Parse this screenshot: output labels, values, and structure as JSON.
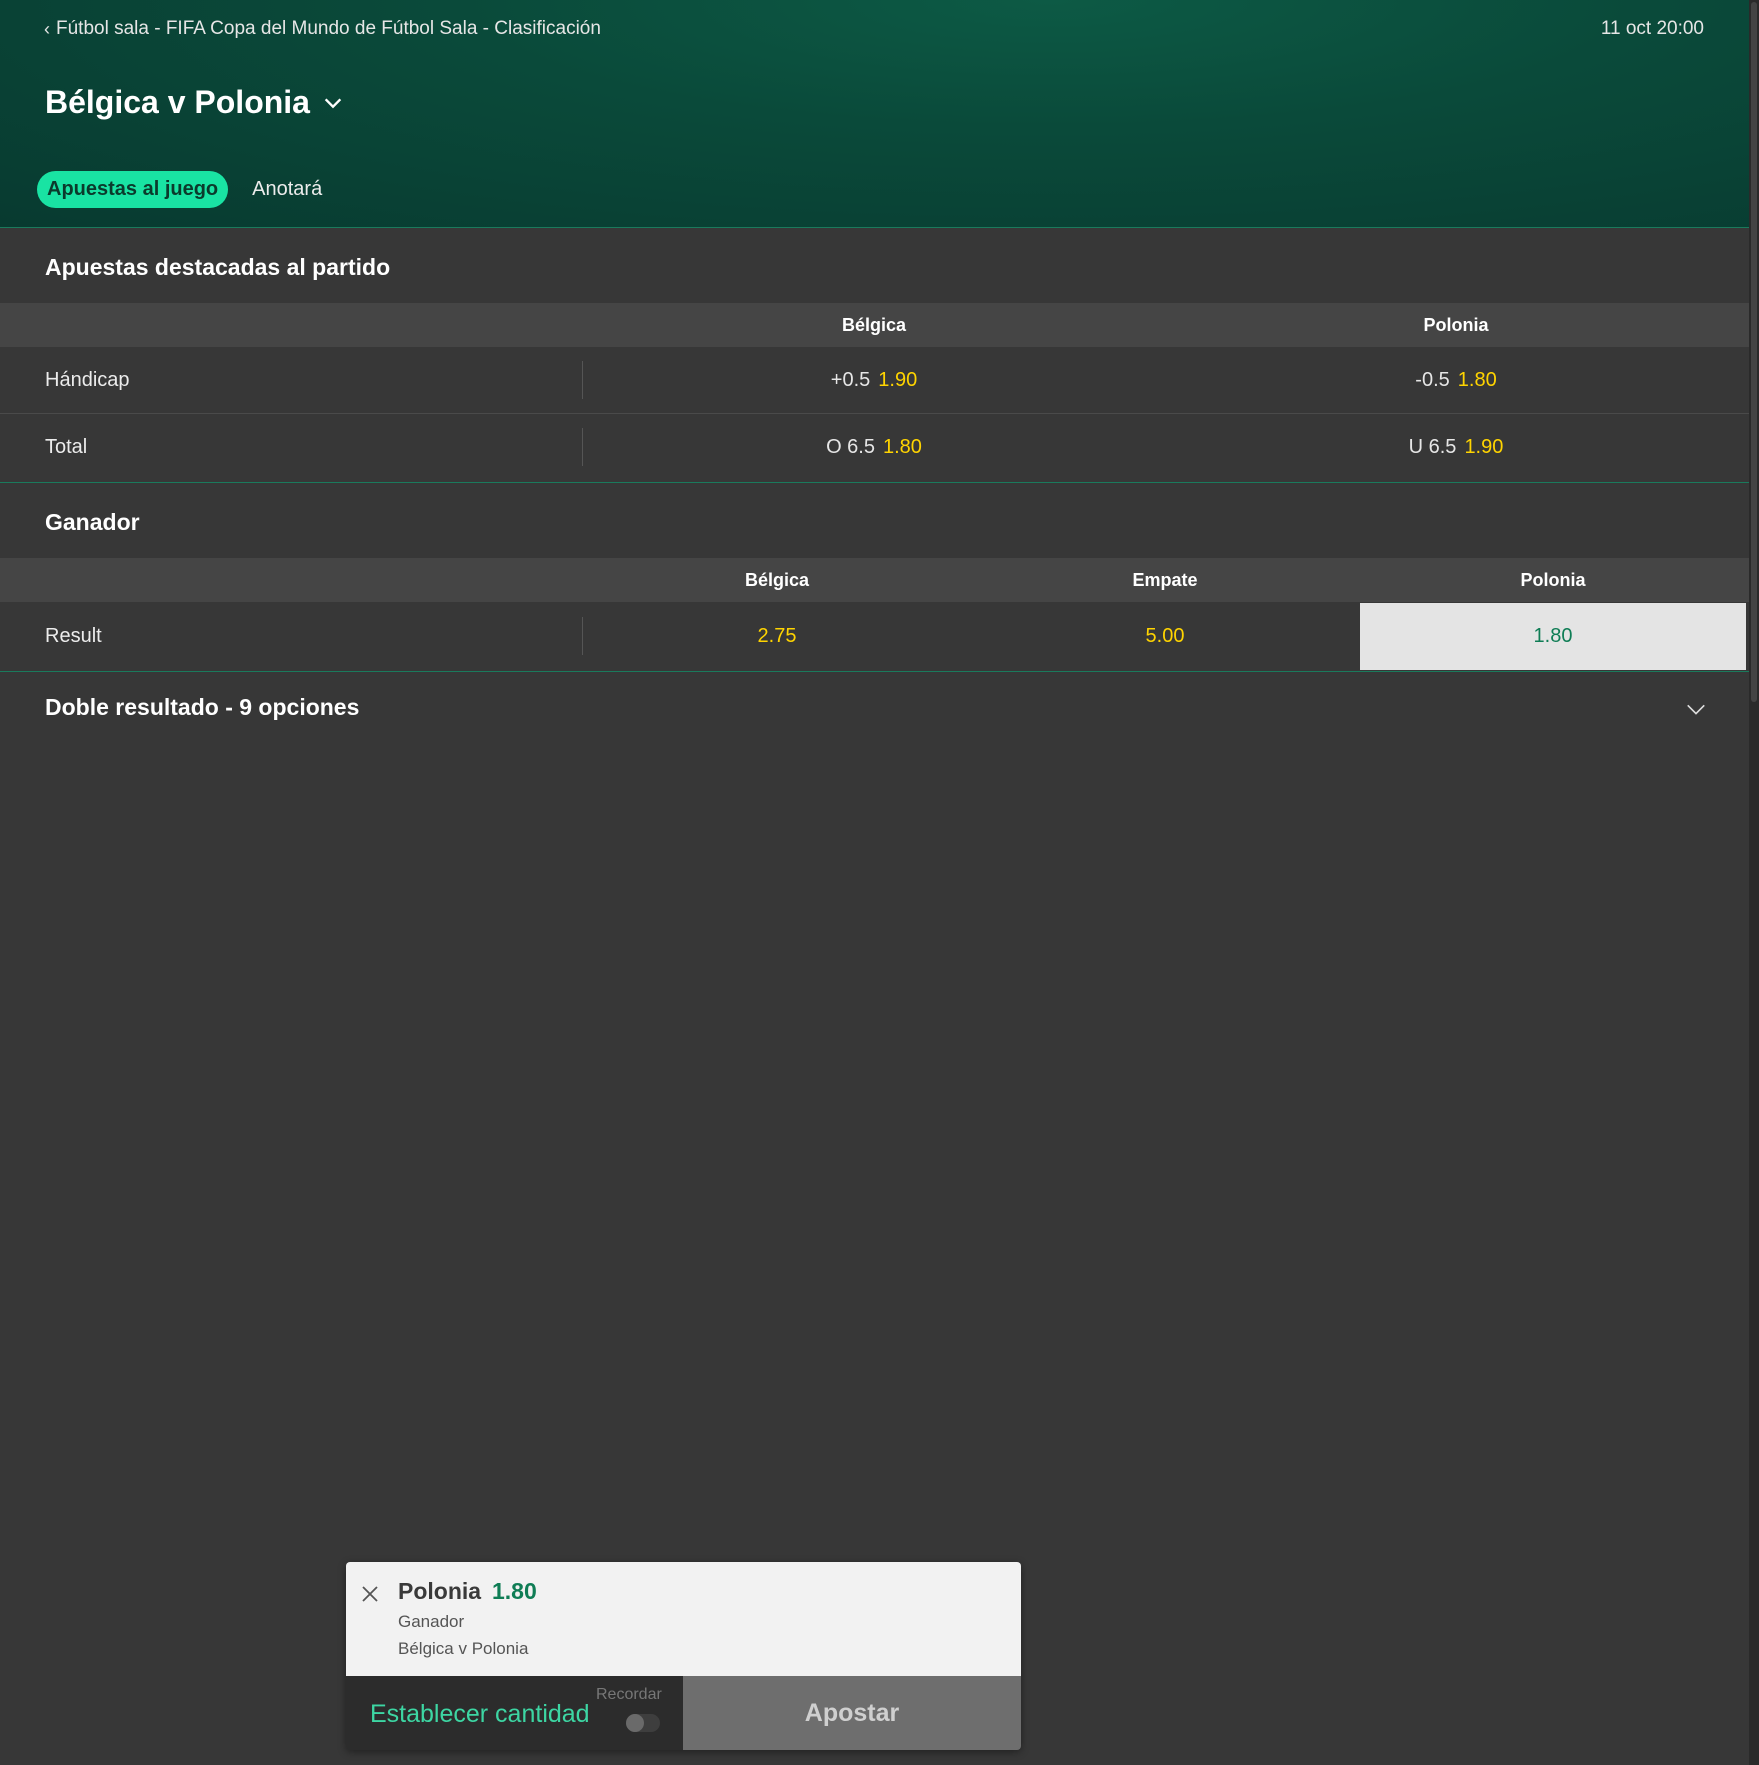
{
  "header": {
    "breadcrumb": "Fútbol sala - FIFA Copa del Mundo de Fútbol Sala - Clasificación",
    "datetime": "11 oct 20:00",
    "match_title": "Bélgica v Polonia",
    "tabs": [
      {
        "label": "Apuestas al juego",
        "active": true
      },
      {
        "label": "Anotará",
        "active": false
      }
    ]
  },
  "featured": {
    "title": "Apuestas destacadas al partido",
    "columns": [
      "Bélgica",
      "Polonia"
    ],
    "rows": [
      {
        "label": "Hándicap",
        "outcomes": [
          {
            "line": "+0.5",
            "price": "1.90"
          },
          {
            "line": "-0.5",
            "price": "1.80"
          }
        ]
      },
      {
        "label": "Total",
        "outcomes": [
          {
            "line": "O 6.5",
            "price": "1.80"
          },
          {
            "line": "U 6.5",
            "price": "1.90"
          }
        ]
      }
    ]
  },
  "winner": {
    "title": "Ganador",
    "columns": [
      "Bélgica",
      "Empate",
      "Polonia"
    ],
    "row": {
      "label": "Result",
      "prices": [
        "2.75",
        "5.00",
        "1.80"
      ],
      "selected_index": 2
    }
  },
  "double_result": {
    "title": "Doble resultado - 9 opciones"
  },
  "betslip": {
    "selection": "Polonia",
    "odd": "1.80",
    "market": "Ganador",
    "event": "Bélgica v Polonia",
    "stake_placeholder": "Establecer cantidad",
    "remember_label": "Recordar",
    "place_bet_label": "Apostar"
  },
  "colors": {
    "accent": "#19e3a3",
    "odds": "#ffd400",
    "selected_odds": "#0f7d55",
    "background": "#373737"
  }
}
